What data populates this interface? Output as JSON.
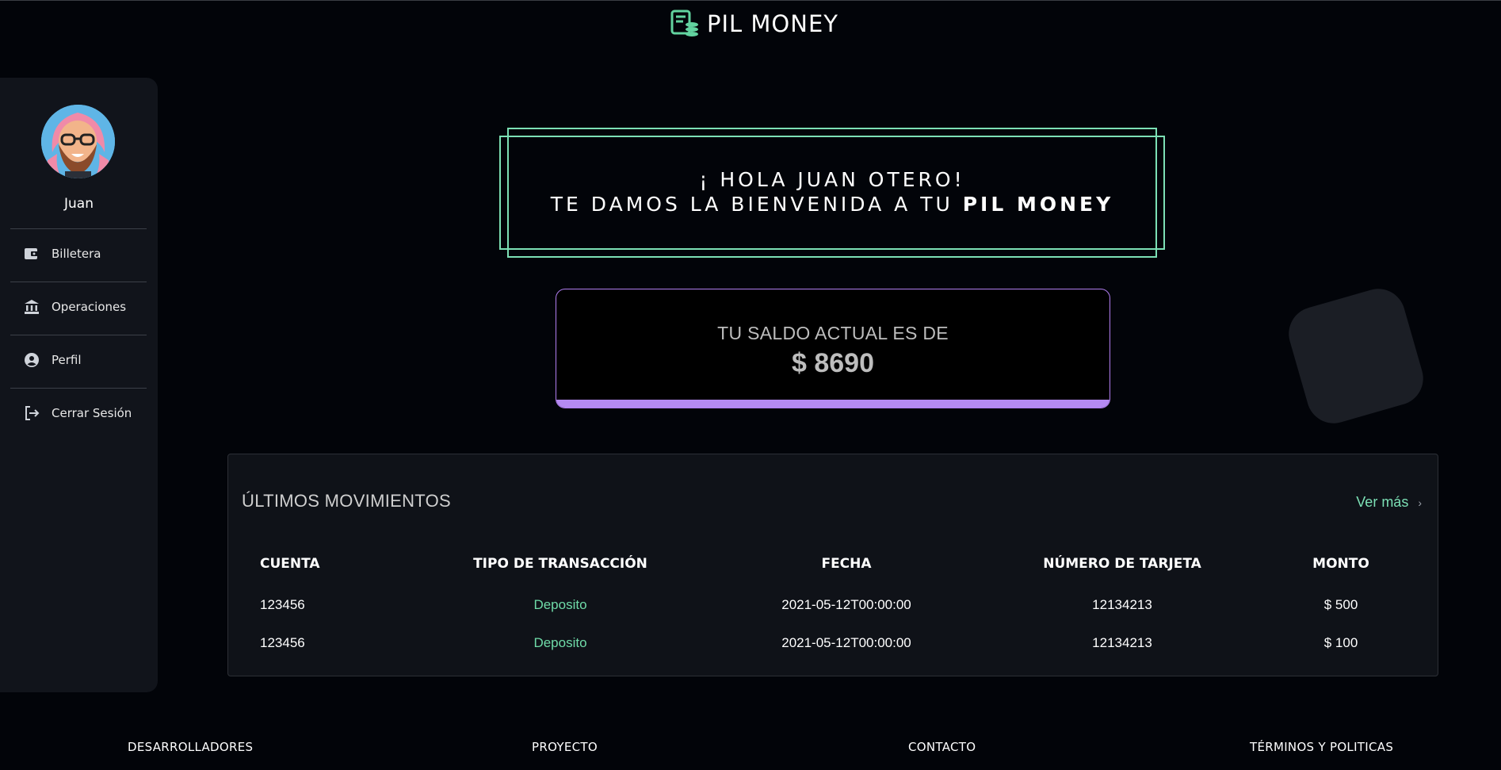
{
  "app": {
    "brand_name": "PIL MONEY",
    "accent": "#7ce0b5",
    "purple": "#b58af2"
  },
  "sidebar": {
    "user_name": "Juan",
    "items": [
      {
        "label": "Billetera",
        "icon": "wallet-icon"
      },
      {
        "label": "Operaciones",
        "icon": "bank-icon"
      },
      {
        "label": "Perfil",
        "icon": "account-circle-icon"
      },
      {
        "label": "Cerrar Sesión",
        "icon": "logout-icon"
      }
    ]
  },
  "greeting": {
    "line1": "¡ HOLA JUAN OTERO!",
    "line2_prefix": "TE DAMOS LA BIENVENIDA A TU ",
    "line2_brand": "PIL MONEY"
  },
  "balance": {
    "label": "TU SALDO ACTUAL ES DE",
    "value": "$ 8690"
  },
  "movements": {
    "title": "ÚLTIMOS MOVIMIENTOS",
    "ver_mas": "Ver más",
    "chevron": "›",
    "headers": [
      "CUENTA",
      "TIPO DE TRANSACCIÓN",
      "FECHA",
      "NÚMERO DE TARJETA",
      "MONTO"
    ],
    "rows": [
      [
        "123456",
        "Deposito",
        "2021-05-12T00:00:00",
        "12134213",
        "$ 500"
      ],
      [
        "123456",
        "Deposito",
        "2021-05-12T00:00:00",
        "12134213",
        "$ 100"
      ]
    ]
  },
  "footer": {
    "links": [
      "DESARROLLADORES",
      "PROYECTO",
      "CONTACTO",
      "TÉRMINOS Y POLITICAS"
    ]
  }
}
